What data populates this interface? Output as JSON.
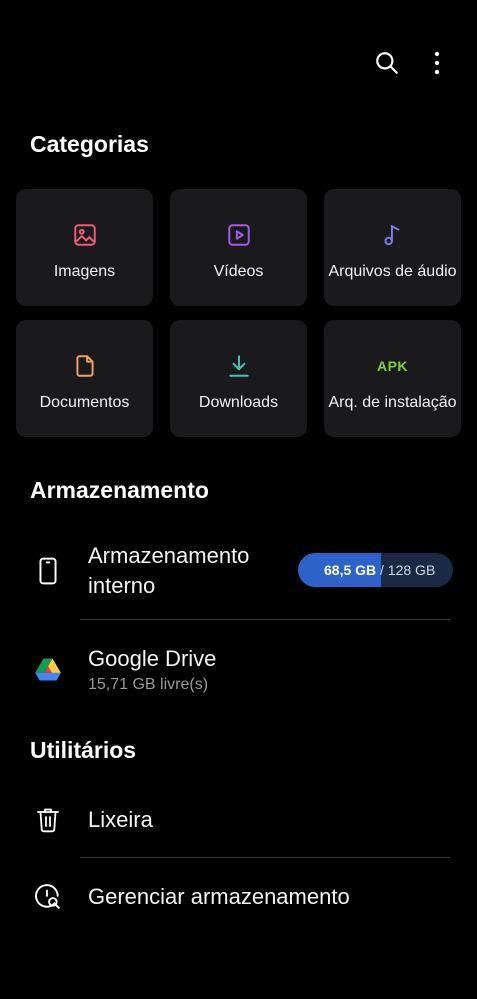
{
  "colors": {
    "background": "#000000",
    "tile": "#1a1a1c",
    "images_accent": "#ef5b7a",
    "videos_accent": "#a25be8",
    "audio_accent": "#7b7cf0",
    "documents_accent": "#f2a265",
    "downloads_accent": "#3fc8b3",
    "apk_accent": "#7bd23c",
    "storage_fill": "#2d62c8"
  },
  "header": {
    "icons": [
      "search-icon",
      "more-vert-icon"
    ]
  },
  "categories": {
    "title": "Categorias",
    "items": [
      {
        "label": "Imagens",
        "icon": "image-icon"
      },
      {
        "label": "Vídeos",
        "icon": "video-icon"
      },
      {
        "label": "Arquivos de áudio",
        "icon": "music-note-icon"
      },
      {
        "label": "Documentos",
        "icon": "document-icon"
      },
      {
        "label": "Downloads",
        "icon": "download-icon"
      },
      {
        "label": "Arq. de instalação",
        "icon": "apk-icon",
        "badge": "APK"
      }
    ]
  },
  "storage": {
    "title": "Armazenamento",
    "internal": {
      "label": "Armazenamento interno",
      "used": "68,5 GB",
      "total": "/ 128 GB",
      "used_fraction": 0.535
    },
    "drive": {
      "label": "Google Drive",
      "free": "15,71 GB livre(s)"
    }
  },
  "utilities": {
    "title": "Utilitários",
    "trash": {
      "label": "Lixeira"
    },
    "manage": {
      "label": "Gerenciar armazenamento"
    }
  }
}
